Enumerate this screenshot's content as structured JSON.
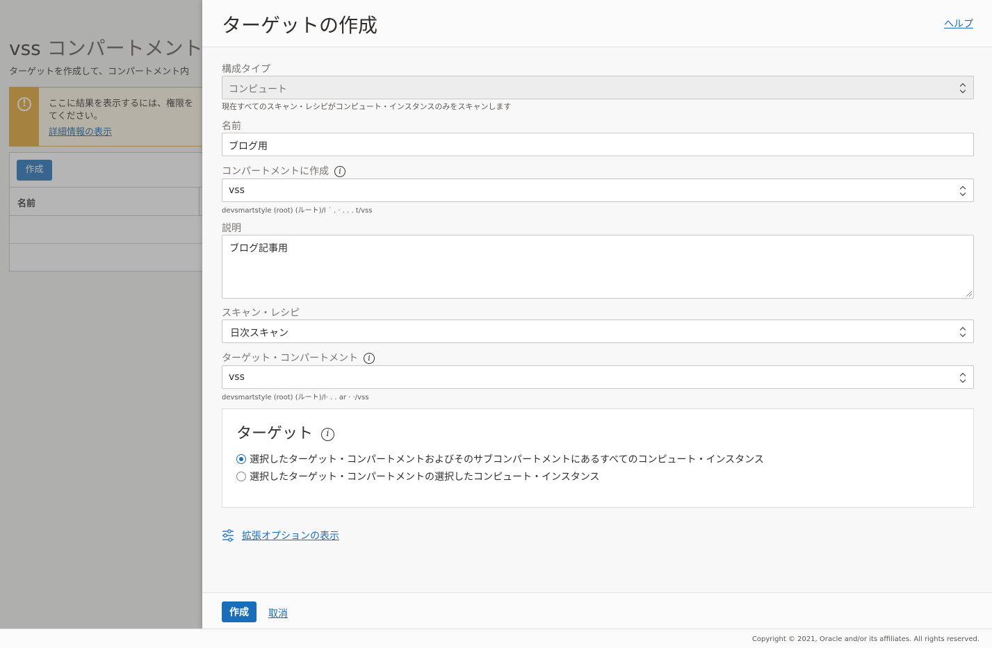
{
  "background": {
    "title_prefix": "vss",
    "title_rest": "コンパートメント内",
    "subtitle": "ターゲットを作成して、コンパートメント内",
    "alert": {
      "line1": "ここに結果を表示するには、権限を",
      "line2": "てください。",
      "link": "詳細情報の表示"
    },
    "create_button": "作成",
    "table_header_name": "名前"
  },
  "drawer": {
    "title": "ターゲットの作成",
    "help_link": "ヘルプ",
    "config_type": {
      "label": "構成タイプ",
      "value": "コンピュート",
      "hint": "現在すべてのスキャン・レシピがコンピュート・インスタンスのみをスキャンします"
    },
    "name": {
      "label": "名前",
      "value": "ブログ用"
    },
    "create_in_compartment": {
      "label": "コンパートメントに作成",
      "value": "vss",
      "path": "devsmartstyle (root) (ルート)/l  ˙ .   ·   .   .   .    t/vss"
    },
    "description": {
      "label": "説明",
      "value": "ブログ記事用"
    },
    "scan_recipe": {
      "label": "スキャン・レシピ",
      "value": "日次スキャン"
    },
    "target_compartment": {
      "label": "ターゲット・コンパートメント",
      "value": "vss",
      "path": "devsmartstyle (root) (ルート)/l·  .   .  ar  ·   ·/vss"
    },
    "targets": {
      "title": "ターゲット",
      "options": [
        {
          "label": "選択したターゲット・コンパートメントおよびそのサブコンパートメントにあるすべてのコンピュート・インスタンス",
          "selected": true
        },
        {
          "label": "選択したターゲット・コンパートメントの選択したコンピュート・インスタンス",
          "selected": false
        }
      ]
    },
    "advanced_options_link": "拡張オプションの表示",
    "footer": {
      "create_button": "作成",
      "cancel_link": "取消"
    }
  },
  "footer": {
    "copyright": "Copyright © 2021, Oracle and/or its affiliates. All rights reserved."
  },
  "colors": {
    "accent": "#1a6db8",
    "warning": "#e2a32a"
  }
}
